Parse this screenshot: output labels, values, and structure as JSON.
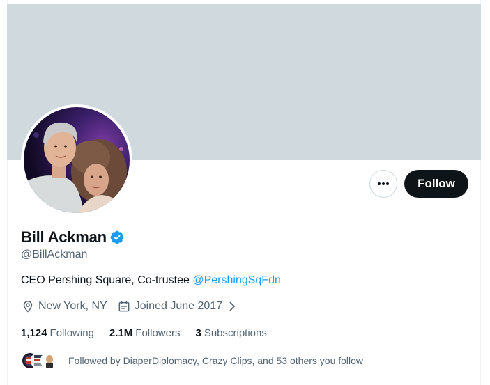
{
  "profile": {
    "display_name": "Bill Ackman",
    "handle": "@BillAckman",
    "bio_text": "CEO Pershing Square, Co-trustee ",
    "bio_mention": "@PershingSqFdn",
    "location": "New York, NY",
    "joined": "Joined June 2017",
    "verified_icon": "verified-badge-icon",
    "banner_color": "#cfd9de"
  },
  "actions": {
    "more_label": "•••",
    "follow_label": "Follow"
  },
  "stats": {
    "following_count": "1,124",
    "following_label": "Following",
    "followers_count": "2.1M",
    "followers_label": "Followers",
    "subscriptions_count": "3",
    "subscriptions_label": "Subscriptions"
  },
  "followed_by": {
    "text": "Followed by DiaperDiplomacy, Crazy Clips, and 53 others you follow"
  },
  "colors": {
    "accent": "#1d9bf0",
    "text_primary": "#0f1419",
    "text_secondary": "#536471",
    "button_dark": "#0f1419"
  }
}
